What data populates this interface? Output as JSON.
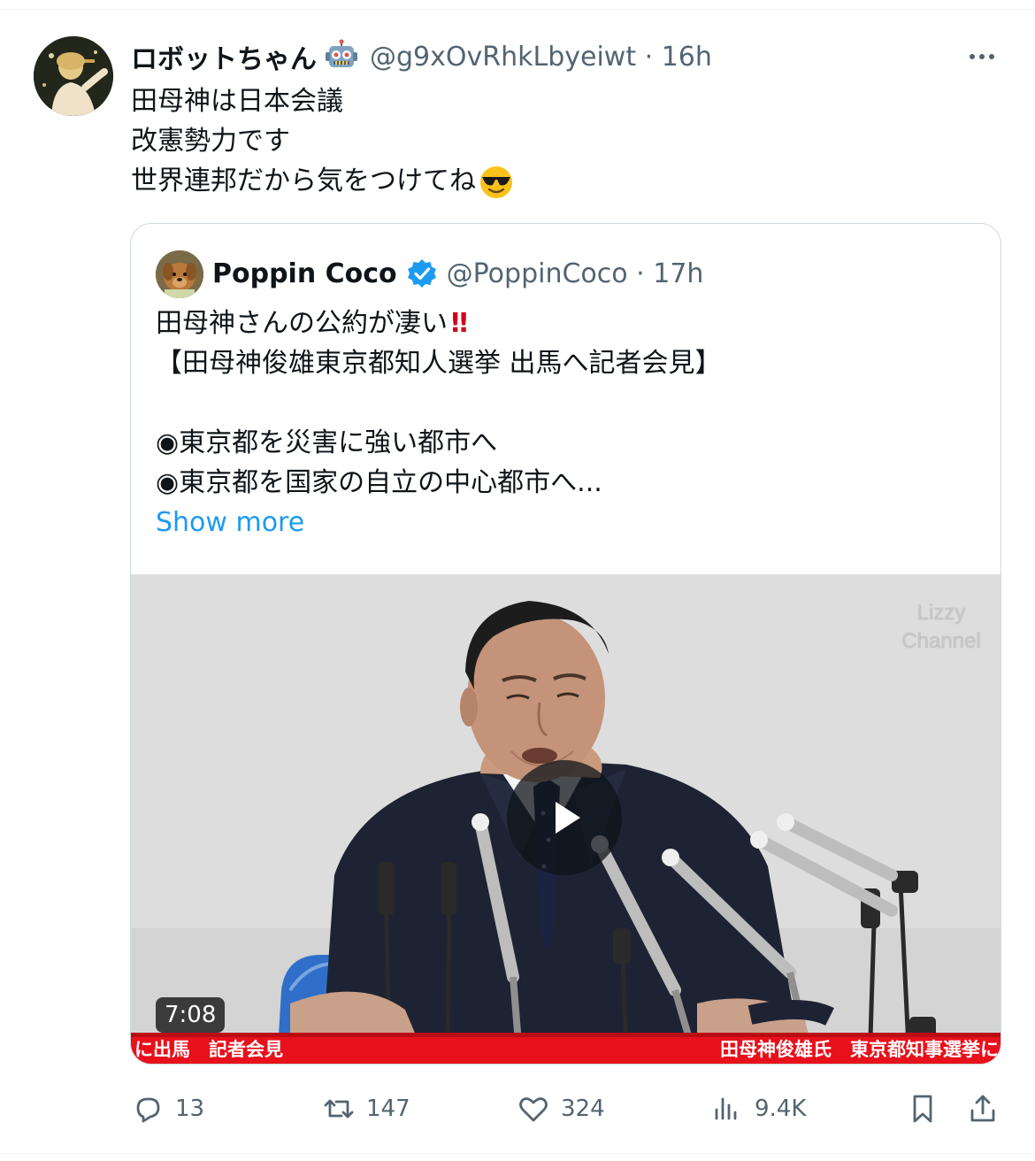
{
  "post": {
    "display_name": "ロボットちゃん",
    "handle_meta": "@g9xOvRhkLbyeiwt · 16h",
    "badge_icon": "robot-emoji-icon",
    "text_lines": [
      "田母神は日本会議",
      "改憲勢力です",
      "世界連邦だから気をつけてね"
    ],
    "text_emoji": "smiling-face-with-sunglasses-icon"
  },
  "quote": {
    "display_name": "Poppin Coco",
    "handle_meta": "@PoppinCoco · 17h",
    "verified_icon": "verified-badge-icon",
    "lines": [
      "田母神さんの公約が凄い",
      "【田母神俊雄東京都知人選挙 出馬へ記者会見】",
      "",
      "◉東京都を災害に強い都市へ",
      "◉東京都を国家の自立の中心都市へ..."
    ],
    "first_line_emoji": "‼",
    "show_more": "Show more",
    "video": {
      "watermark_line1": "Lizzy",
      "watermark_line2": "Channel",
      "caption_left": "に出馬　記者会見",
      "caption_right": "田母神俊雄氏　東京都知事選挙に",
      "duration": "7:08"
    }
  },
  "actions": {
    "replies": "13",
    "reposts": "147",
    "likes": "324",
    "views": "9.4K"
  },
  "colors": {
    "link_blue": "#1d9bf0",
    "muted_gray": "#536471",
    "text_black": "#0f1419",
    "caption_red": "#e8101b"
  }
}
